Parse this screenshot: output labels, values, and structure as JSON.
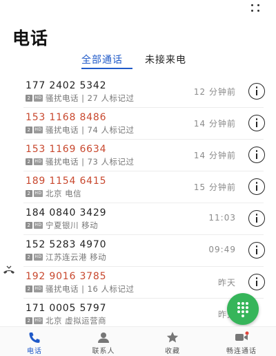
{
  "header": {
    "title": "电话"
  },
  "tabs": [
    {
      "label": "全部通话",
      "active": true
    },
    {
      "label": "未接来电",
      "active": false
    }
  ],
  "calls": [
    {
      "number": "177 2402 5342",
      "missed": false,
      "sim": "2",
      "hd": "HD",
      "detail": "骚扰电话 | 27 人标记过",
      "time": "12 分钟前"
    },
    {
      "number": "153 1168 8486",
      "missed": true,
      "sim": "2",
      "hd": "HD",
      "detail": "骚扰电话 | 74 人标记过",
      "time": "14 分钟前"
    },
    {
      "number": "153 1169 6634",
      "missed": true,
      "sim": "2",
      "hd": "HD",
      "detail": "骚扰电话 | 73 人标记过",
      "time": "14 分钟前"
    },
    {
      "number": "189 1154 6415",
      "missed": true,
      "sim": "2",
      "hd": "HD",
      "detail": "北京 电信",
      "time": "15 分钟前"
    },
    {
      "number": "184 0840 3429",
      "missed": false,
      "sim": "2",
      "hd": "HD",
      "detail": "宁夏银川 移动",
      "time": "11:03"
    },
    {
      "number": "152 5283 4970",
      "missed": false,
      "sim": "2",
      "hd": "HD",
      "detail": "江苏连云港 移动",
      "time": "09:49"
    },
    {
      "number": "192 9016 3785",
      "missed": true,
      "sim": "2",
      "hd": "HD",
      "detail": "骚扰电话 | 16 人标记过",
      "time": "昨天"
    },
    {
      "number": "171 0005 5797",
      "missed": false,
      "sim": "2",
      "hd": "HD",
      "detail": "北京 虚拟运营商",
      "time": "昨天"
    }
  ],
  "bottom_nav": [
    {
      "label": "电话",
      "icon": "phone-icon",
      "active": true
    },
    {
      "label": "联系人",
      "icon": "contacts-icon",
      "active": false
    },
    {
      "label": "收藏",
      "icon": "star-icon",
      "active": false
    },
    {
      "label": "畅连通话",
      "icon": "video-call-icon",
      "active": false
    }
  ],
  "colors": {
    "accent": "#1f59c8",
    "missed": "#c8472d",
    "fab": "#36b55a"
  }
}
